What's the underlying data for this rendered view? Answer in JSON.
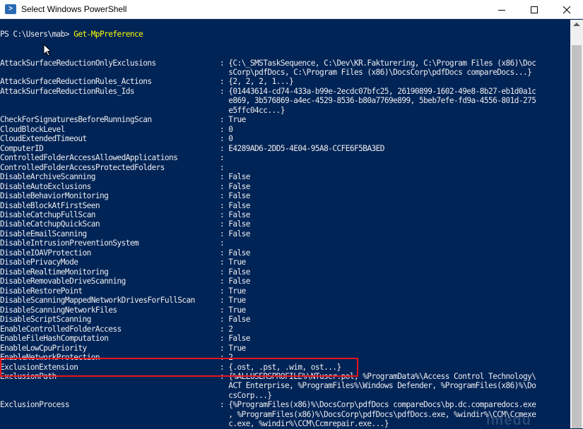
{
  "window": {
    "title": "Select Windows PowerShell",
    "app_icon": "powershell-icon",
    "minimize": "minimize-icon",
    "maximize": "maximize-icon",
    "close": "close-icon"
  },
  "colors": {
    "console_bg": "#012456",
    "console_fg": "#eeedf0",
    "command": "#ffff00",
    "highlight": "#e8141b"
  },
  "prompt": {
    "path": "PS C:\\Users\\mab> ",
    "command": "Get-MpPreference"
  },
  "rows": [
    {
      "key": "AttackSurfaceReductionOnlyExclusions",
      "sep": ":",
      "value": "{C:\\_SMSTaskSequence, C:\\Dev\\KR.Fakturering, C:\\Program Files (x86)\\Doc"
    },
    {
      "key": "",
      "sep": "",
      "value": "sCorp\\pdfDocs, C:\\Program Files (x86)\\DocsCorp\\pdfDocs compareDocs...}"
    },
    {
      "key": "AttackSurfaceReductionRules_Actions",
      "sep": ":",
      "value": "{2, 2, 2, 1...}"
    },
    {
      "key": "AttackSurfaceReductionRules_Ids",
      "sep": ":",
      "value": "{01443614-cd74-433a-b99e-2ecdc07bfc25, 26190899-1602-49e8-8b27-eb1d0a1c"
    },
    {
      "key": "",
      "sep": "",
      "value": "e869, 3b576869-a4ec-4529-8536-b80a7769e899, 5beb7efe-fd9a-4556-801d-275"
    },
    {
      "key": "",
      "sep": "",
      "value": "e5ffc04cc...}"
    },
    {
      "key": "CheckForSignaturesBeforeRunningScan",
      "sep": ":",
      "value": "True"
    },
    {
      "key": "CloudBlockLevel",
      "sep": ":",
      "value": "0"
    },
    {
      "key": "CloudExtendedTimeout",
      "sep": ":",
      "value": "0"
    },
    {
      "key": "ComputerID",
      "sep": ":",
      "value": "E4289AD6-2DD5-4E04-95A8-CCFE6F5BA3ED"
    },
    {
      "key": "ControlledFolderAccessAllowedApplications",
      "sep": ":",
      "value": ""
    },
    {
      "key": "ControlledFolderAccessProtectedFolders",
      "sep": ":",
      "value": ""
    },
    {
      "key": "DisableArchiveScanning",
      "sep": ":",
      "value": "False"
    },
    {
      "key": "DisableAutoExclusions",
      "sep": ":",
      "value": "False"
    },
    {
      "key": "DisableBehaviorMonitoring",
      "sep": ":",
      "value": "False"
    },
    {
      "key": "DisableBlockAtFirstSeen",
      "sep": ":",
      "value": "False"
    },
    {
      "key": "DisableCatchupFullScan",
      "sep": ":",
      "value": "False"
    },
    {
      "key": "DisableCatchupQuickScan",
      "sep": ":",
      "value": "False"
    },
    {
      "key": "DisableEmailScanning",
      "sep": ":",
      "value": "False"
    },
    {
      "key": "DisableIntrusionPreventionSystem",
      "sep": ":",
      "value": ""
    },
    {
      "key": "DisableIOAVProtection",
      "sep": ":",
      "value": "False"
    },
    {
      "key": "DisablePrivacyMode",
      "sep": ":",
      "value": "True"
    },
    {
      "key": "DisableRealtimeMonitoring",
      "sep": ":",
      "value": "False"
    },
    {
      "key": "DisableRemovableDriveScanning",
      "sep": ":",
      "value": "False"
    },
    {
      "key": "DisableRestorePoint",
      "sep": ":",
      "value": "True"
    },
    {
      "key": "DisableScanningMappedNetworkDrivesForFullScan",
      "sep": ":",
      "value": "True"
    },
    {
      "key": "DisableScanningNetworkFiles",
      "sep": ":",
      "value": "True"
    },
    {
      "key": "DisableScriptScanning",
      "sep": ":",
      "value": "False"
    },
    {
      "key": "EnableControlledFolderAccess",
      "sep": ":",
      "value": "2"
    },
    {
      "key": "EnableFileHashComputation",
      "sep": ":",
      "value": "False"
    },
    {
      "key": "EnableLowCpuPriority",
      "sep": ":",
      "value": "True"
    },
    {
      "key": "EnableNetworkProtection",
      "sep": ":",
      "value": "2"
    },
    {
      "key": "ExclusionExtension",
      "sep": ":",
      "value": "{.ost, .pst, .wim, ost...}"
    },
    {
      "key": "ExclusionPath",
      "sep": ":",
      "value": "{%ALLUSERSPROFILE%\\NTuser.pol, %ProgramData%\\Access Control Technology\\"
    },
    {
      "key": "",
      "sep": "",
      "value": "ACT Enterprise, %ProgramFiles%\\Windows Defender, %ProgramFiles(x86)%\\Do"
    },
    {
      "key": "",
      "sep": "",
      "value": "csCorp...}"
    },
    {
      "key": "ExclusionProcess",
      "sep": ":",
      "value": "{%ProgramFiles(x86)%\\DocsCorp\\pdfDocs compareDocs\\bp.dc.comparedocs.exe"
    },
    {
      "key": "",
      "sep": "",
      "value": ", %ProgramFiles(x86)%\\DocsCorp\\pdfDocs\\pdfDocs.exe, %windir%\\CCM\\Ccmexe"
    },
    {
      "key": "",
      "sep": "",
      "value": "c.exe, %windir%\\CCM\\Ccmrepair.exe...}"
    }
  ]
}
